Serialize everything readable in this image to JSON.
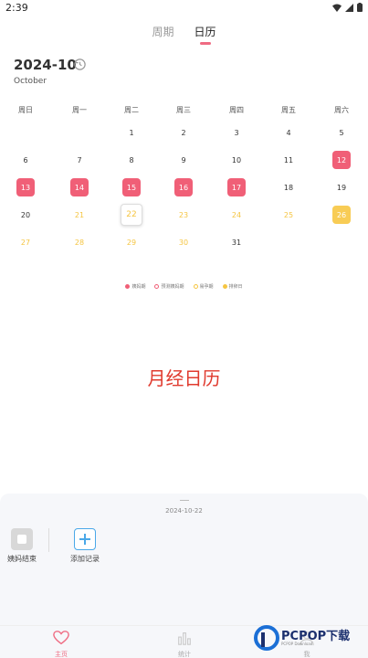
{
  "status_bar": {
    "time": "2:39"
  },
  "top_tabs": [
    {
      "label": "周期",
      "active": false
    },
    {
      "label": "日历",
      "active": true
    }
  ],
  "header": {
    "month": "2024-10",
    "month_name": "October"
  },
  "weekdays": [
    "周日",
    "周一",
    "周二",
    "周三",
    "周四",
    "周五",
    "周六"
  ],
  "calendar": [
    {
      "day": "1",
      "state": "normal"
    },
    {
      "day": "2",
      "state": "normal"
    },
    {
      "day": "3",
      "state": "normal"
    },
    {
      "day": "4",
      "state": "normal"
    },
    {
      "day": "5",
      "state": "normal"
    },
    {
      "day": "6",
      "state": "normal"
    },
    {
      "day": "7",
      "state": "normal"
    },
    {
      "day": "8",
      "state": "normal"
    },
    {
      "day": "9",
      "state": "normal"
    },
    {
      "day": "10",
      "state": "normal"
    },
    {
      "day": "11",
      "state": "normal"
    },
    {
      "day": "12",
      "state": "period"
    },
    {
      "day": "13",
      "state": "period"
    },
    {
      "day": "14",
      "state": "period"
    },
    {
      "day": "15",
      "state": "period"
    },
    {
      "day": "16",
      "state": "period"
    },
    {
      "day": "17",
      "state": "period"
    },
    {
      "day": "18",
      "state": "normal"
    },
    {
      "day": "19",
      "state": "normal"
    },
    {
      "day": "20",
      "state": "normal"
    },
    {
      "day": "21",
      "state": "fertile"
    },
    {
      "day": "22",
      "state": "today"
    },
    {
      "day": "23",
      "state": "fertile"
    },
    {
      "day": "24",
      "state": "fertile"
    },
    {
      "day": "25",
      "state": "fertile"
    },
    {
      "day": "26",
      "state": "ovulation"
    },
    {
      "day": "27",
      "state": "fertile"
    },
    {
      "day": "28",
      "state": "fertile"
    },
    {
      "day": "29",
      "state": "fertile"
    },
    {
      "day": "30",
      "state": "fertile"
    },
    {
      "day": "31",
      "state": "normal"
    }
  ],
  "legend": [
    {
      "label": "姨妈期",
      "color": "#f05f77",
      "style": "filled"
    },
    {
      "label": "预测姨妈期",
      "color": "#f05f77",
      "style": "outline"
    },
    {
      "label": "易孕期",
      "color": "#f5c542",
      "style": "outline"
    },
    {
      "label": "排卵日",
      "color": "#f5c542",
      "style": "filled"
    }
  ],
  "watermark": "月经日历",
  "panel": {
    "date": "2024-10-22",
    "actions": [
      {
        "label": "姨妈结束",
        "icon": "stop-icon"
      },
      {
        "label": "添加记录",
        "icon": "plus-icon"
      }
    ]
  },
  "bottom_nav": [
    {
      "label": "主页",
      "icon": "heart-icon",
      "active": true
    },
    {
      "label": "统计",
      "icon": "bar-chart-icon",
      "active": false
    },
    {
      "label": "我",
      "icon": "user-icon",
      "active": false
    }
  ],
  "logo": {
    "text": "PCPOP下载",
    "sub": "PCPOP Download"
  },
  "colors": {
    "accent": "#ef6b82",
    "period": "#f05f77",
    "fertile": "#f5c542",
    "watermark": "#e03a2e"
  }
}
